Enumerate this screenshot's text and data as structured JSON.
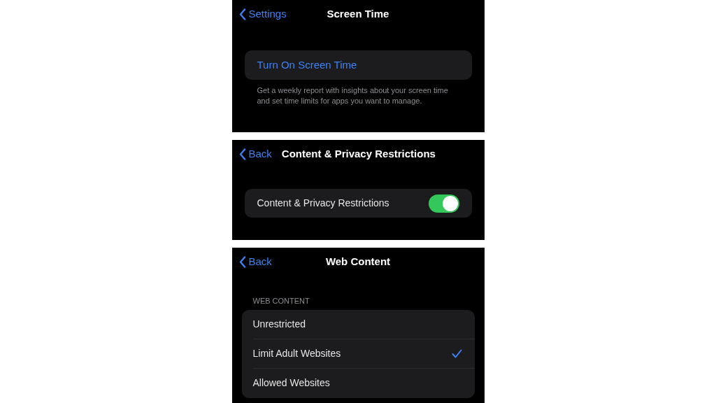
{
  "screens": [
    {
      "kind": "intro",
      "nav": {
        "back": "Settings",
        "title": "Screen Time"
      },
      "action": "Turn On Screen Time",
      "footer": "Get a weekly report with insights about your screen time and set time limits for apps you want to manage."
    },
    {
      "kind": "toggle",
      "nav": {
        "back": "Back",
        "title": "Content & Privacy Restrictions"
      },
      "setting": {
        "label": "Content & Privacy Restrictions",
        "on": true
      }
    },
    {
      "kind": "options",
      "nav": {
        "back": "Back",
        "title": "Web Content"
      },
      "header": "WEB CONTENT",
      "options": [
        {
          "label": "Unrestricted",
          "selected": false
        },
        {
          "label": "Limit Adult Websites",
          "selected": true
        },
        {
          "label": "Allowed Websites",
          "selected": false
        }
      ]
    }
  ]
}
